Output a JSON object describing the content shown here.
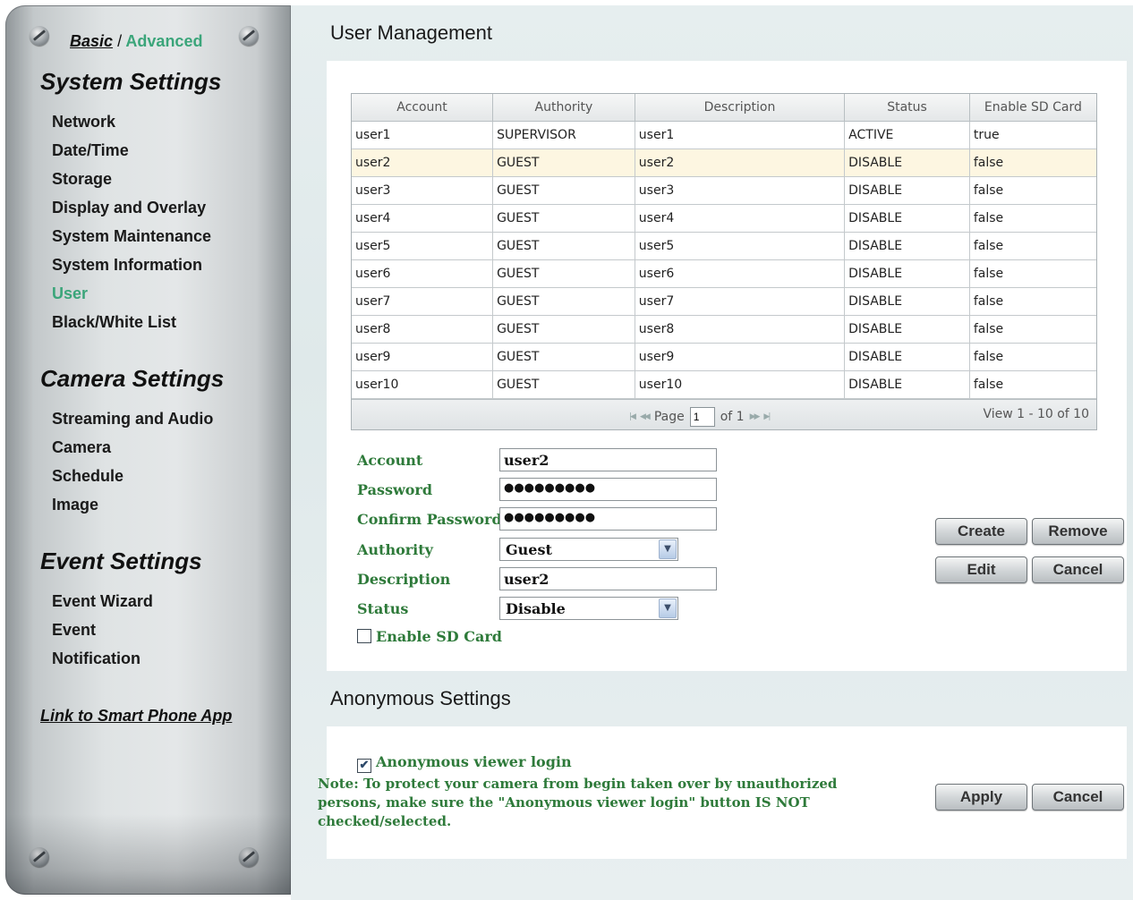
{
  "sidebar": {
    "mode": {
      "basic": "Basic",
      "separator": "/",
      "advanced": "Advanced"
    },
    "system_title": "System Settings",
    "system_items": [
      "Network",
      "Date/Time",
      "Storage",
      "Display and Overlay",
      "System Maintenance",
      "System Information",
      "User",
      "Black/White List"
    ],
    "camera_title": "Camera Settings",
    "camera_items": [
      "Streaming and Audio",
      "Camera",
      "Schedule",
      "Image"
    ],
    "event_title": "Event Settings",
    "event_items": [
      "Event Wizard",
      "Event",
      "Notification"
    ],
    "phone_link": "Link to Smart Phone App"
  },
  "user_mgmt": {
    "title": "User Management",
    "columns": [
      "Account",
      "Authority",
      "Description",
      "Status",
      "Enable SD Card"
    ],
    "rows": [
      [
        "user1",
        "SUPERVISOR",
        "user1",
        "ACTIVE",
        "true"
      ],
      [
        "user2",
        "GUEST",
        "user2",
        "DISABLE",
        "false"
      ],
      [
        "user3",
        "GUEST",
        "user3",
        "DISABLE",
        "false"
      ],
      [
        "user4",
        "GUEST",
        "user4",
        "DISABLE",
        "false"
      ],
      [
        "user5",
        "GUEST",
        "user5",
        "DISABLE",
        "false"
      ],
      [
        "user6",
        "GUEST",
        "user6",
        "DISABLE",
        "false"
      ],
      [
        "user7",
        "GUEST",
        "user7",
        "DISABLE",
        "false"
      ],
      [
        "user8",
        "GUEST",
        "user8",
        "DISABLE",
        "false"
      ],
      [
        "user9",
        "GUEST",
        "user9",
        "DISABLE",
        "false"
      ],
      [
        "user10",
        "GUEST",
        "user10",
        "DISABLE",
        "false"
      ]
    ],
    "selected_row": 1,
    "pager": {
      "page_label": "Page",
      "page_value": "1",
      "of_label": "of 1",
      "view_info": "View 1 - 10 of 10"
    },
    "form": {
      "account_label": "Account",
      "account_value": "user2",
      "password_label": "Password",
      "password_value": "●●●●●●●●●",
      "confirm_label": "Confirm Password",
      "confirm_value": "●●●●●●●●●",
      "authority_label": "Authority",
      "authority_value": "Guest",
      "description_label": "Description",
      "description_value": "user2",
      "status_label": "Status",
      "status_value": "Disable",
      "sd_card_label": "Enable SD Card",
      "sd_card_checked": false
    },
    "buttons": {
      "create": "Create",
      "remove": "Remove",
      "edit": "Edit",
      "cancel": "Cancel"
    }
  },
  "anonymous": {
    "title": "Anonymous Settings",
    "checkbox_label": "Anonymous viewer login",
    "checkbox_checked": true,
    "note": "Note: To protect your camera from begin taken over by unauthorized persons, make sure the \"Anonymous viewer login\" button IS NOT checked/selected.",
    "buttons": {
      "apply": "Apply",
      "cancel": "Cancel"
    }
  },
  "colors": {
    "accent_green": "#3ba57a",
    "label_green": "#2e7a3a",
    "selected_row": "#fdf6e1"
  }
}
